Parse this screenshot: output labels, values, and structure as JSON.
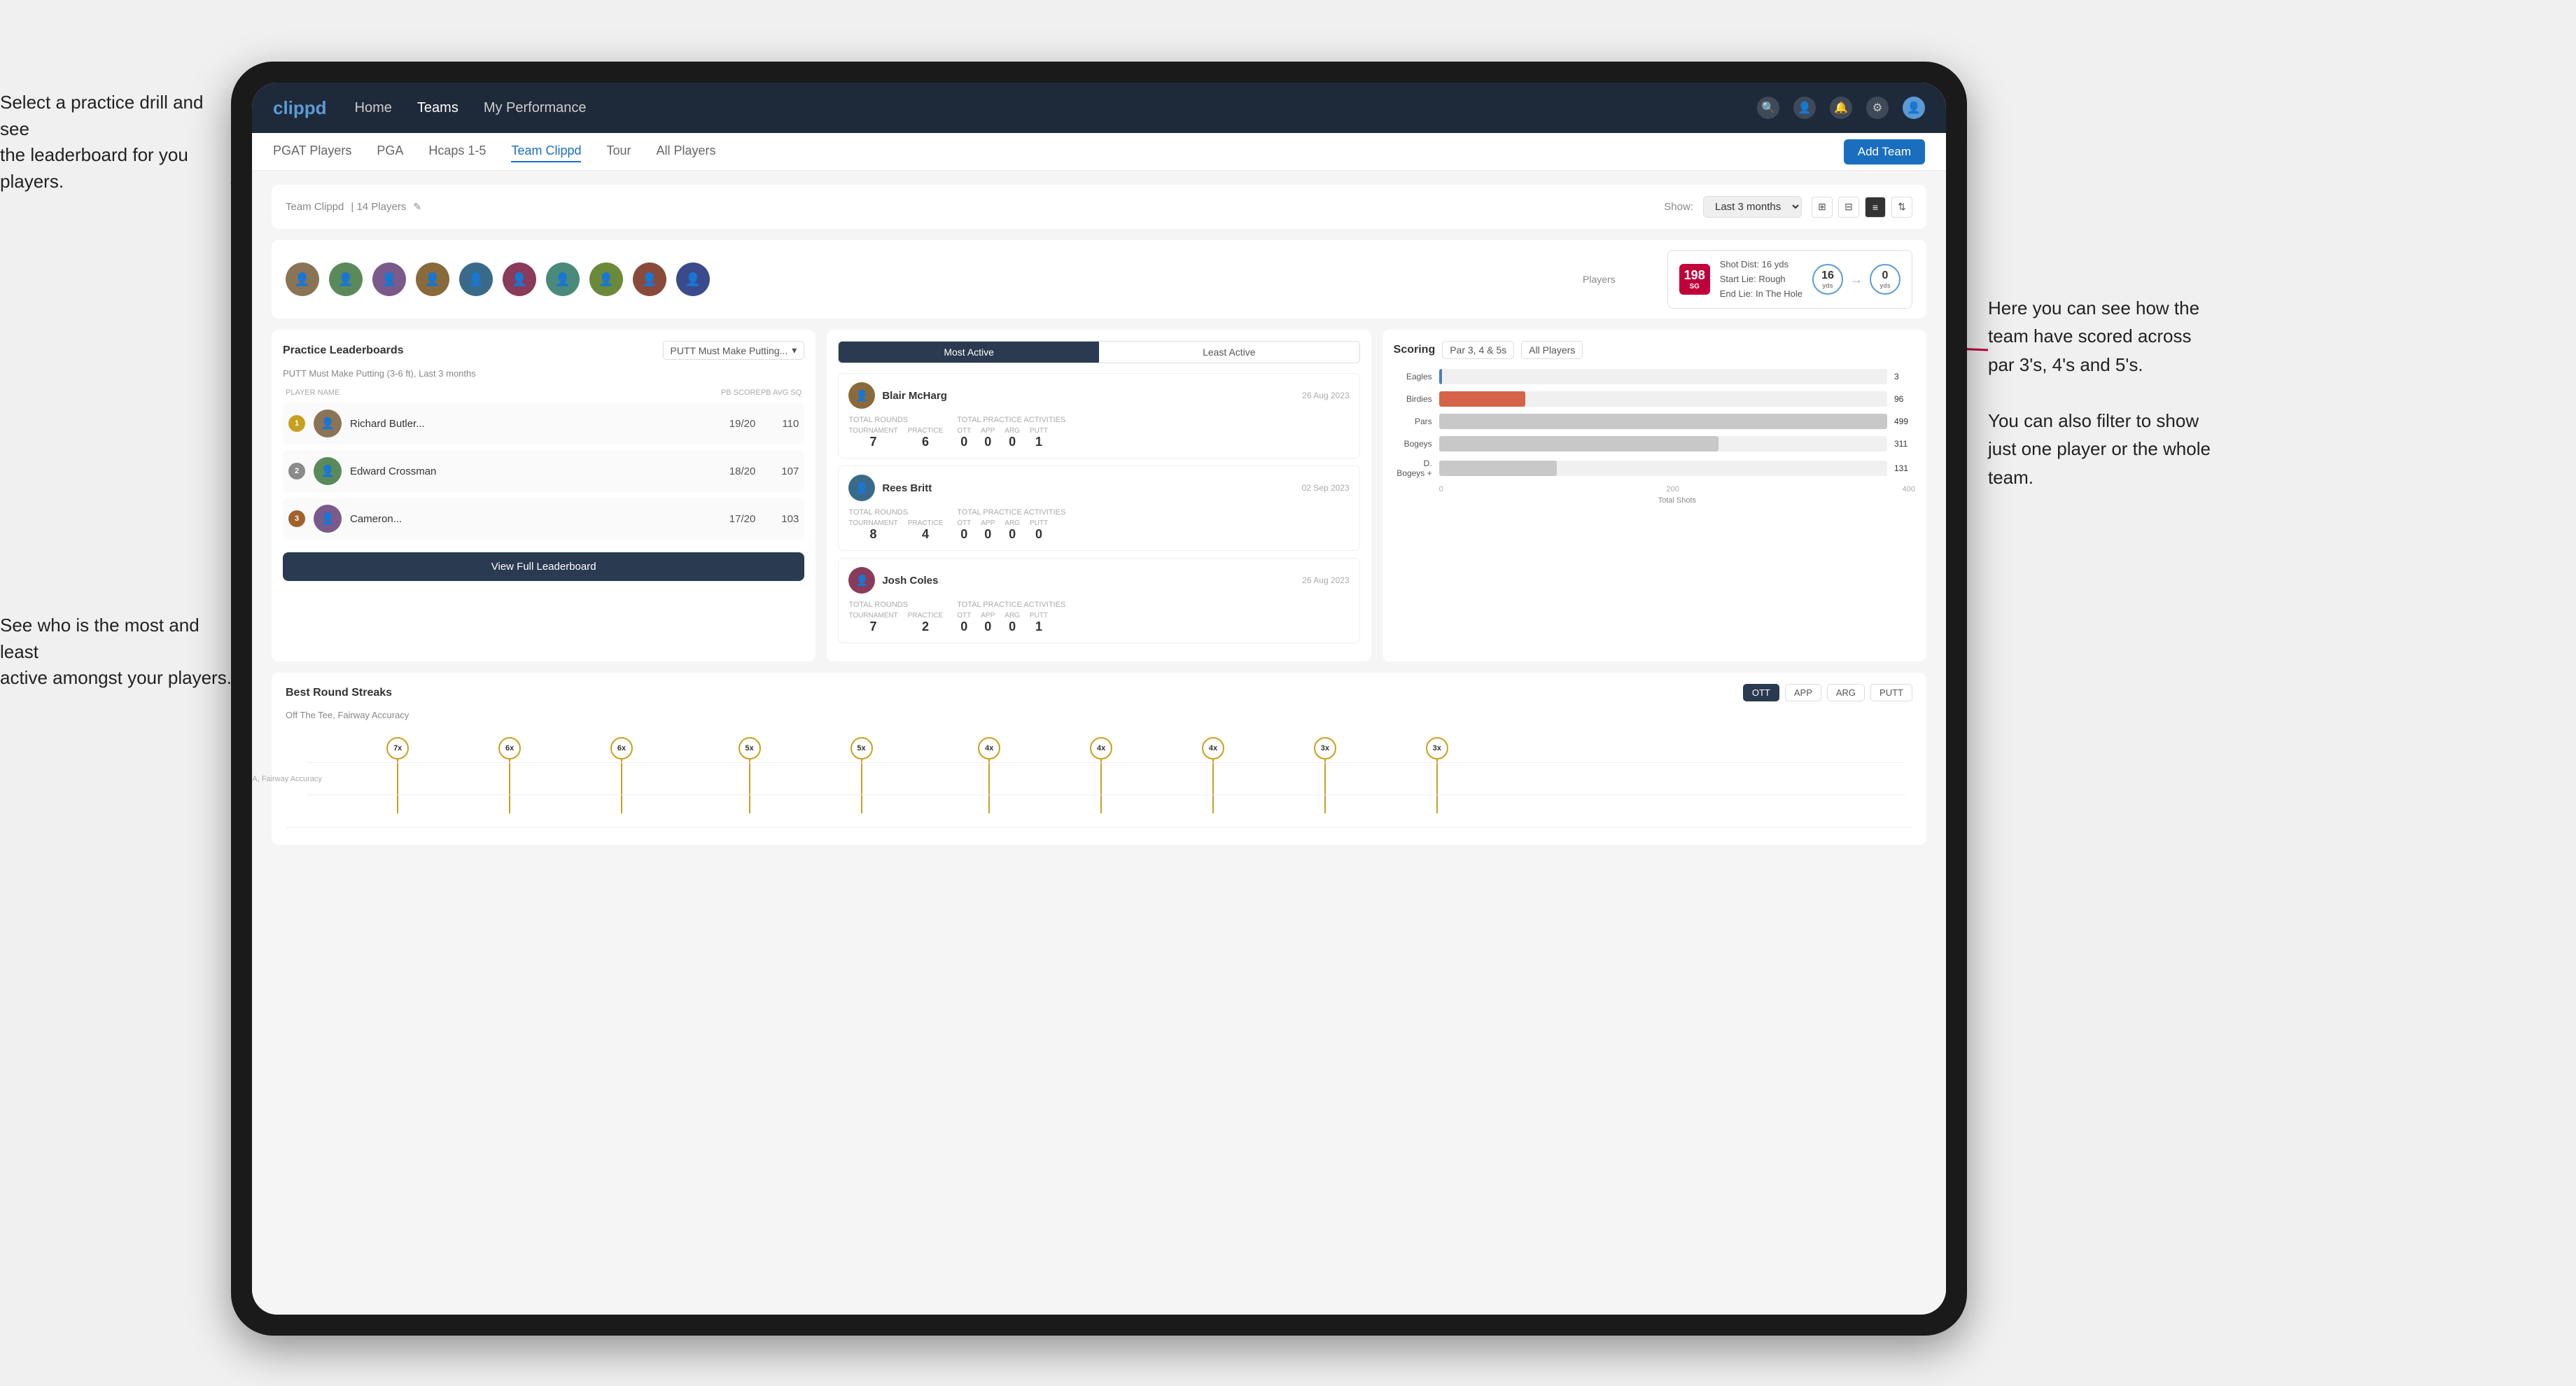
{
  "annotations": {
    "top_left": "Select a practice drill and see\nthe leaderboard for you players.",
    "bottom_left": "See who is the most and least\nactive amongst your players.",
    "top_right": "Here you can see how the\nteam have scored across\npar 3's, 4's and 5's.\n\nYou can also filter to show\njust one player or the whole\nteam.",
    "arrow1_label": "",
    "arrow2_label": ""
  },
  "navbar": {
    "logo": "clippd",
    "links": [
      "Home",
      "Teams",
      "My Performance"
    ],
    "active_link": "Teams",
    "icons": [
      "search",
      "user",
      "bell",
      "settings",
      "avatar"
    ]
  },
  "subtabs": {
    "tabs": [
      "PGAT Players",
      "PGA",
      "Hcaps 1-5",
      "Team Clippd",
      "Tour",
      "All Players"
    ],
    "active_tab": "Team Clippd",
    "add_button": "Add Team"
  },
  "team_header": {
    "title": "Team Clippd",
    "player_count": "14 Players",
    "show_label": "Show:",
    "period": "Last 3 months",
    "view_options": [
      "grid-small",
      "grid-medium",
      "list",
      "sort"
    ]
  },
  "players_section": {
    "label": "Players",
    "avatars": [
      "A",
      "B",
      "C",
      "D",
      "E",
      "F",
      "G",
      "H",
      "I",
      "J"
    ],
    "score_card": {
      "badge": "198",
      "badge_sub": "SG",
      "details_line1": "Shot Dist: 16 yds",
      "details_line2": "Start Lie: Rough",
      "details_line3": "End Lie: In The Hole",
      "circle1": "16",
      "circle1_label": "yds",
      "circle2": "0",
      "circle2_label": "yds"
    }
  },
  "practice_leaderboard": {
    "title": "Practice Leaderboards",
    "drill": "PUTT Must Make Putting...",
    "subtitle": "PUTT Must Make Putting (3-6 ft), Last 3 months",
    "col_player": "PLAYER NAME",
    "col_score": "PB SCORE",
    "col_avg": "PB AVG SQ",
    "players": [
      {
        "rank": 1,
        "rank_color": "gold",
        "name": "Richard Butler...",
        "score": "19/20",
        "avg": "110"
      },
      {
        "rank": 2,
        "rank_color": "silver",
        "name": "Edward Crossman",
        "score": "18/20",
        "avg": "107"
      },
      {
        "rank": 3,
        "rank_color": "bronze",
        "name": "Cameron...",
        "score": "17/20",
        "avg": "103"
      }
    ],
    "view_button": "View Full Leaderboard"
  },
  "activity_panel": {
    "tab_active": "Most Active",
    "tab_inactive": "Least Active",
    "players": [
      {
        "name": "Blair McHarg",
        "date": "26 Aug 2023",
        "total_rounds_label": "Total Rounds",
        "tournament": "7",
        "practice": "6",
        "practice_activities_label": "Total Practice Activities",
        "ott": "0",
        "app": "0",
        "arg": "0",
        "putt": "1"
      },
      {
        "name": "Rees Britt",
        "date": "02 Sep 2023",
        "total_rounds_label": "Total Rounds",
        "tournament": "8",
        "practice": "4",
        "practice_activities_label": "Total Practice Activities",
        "ott": "0",
        "app": "0",
        "arg": "0",
        "putt": "0"
      },
      {
        "name": "Josh Coles",
        "date": "26 Aug 2023",
        "total_rounds_label": "Total Rounds",
        "tournament": "7",
        "practice": "2",
        "practice_activities_label": "Total Practice Activities",
        "ott": "0",
        "app": "0",
        "arg": "0",
        "putt": "1"
      }
    ]
  },
  "scoring_panel": {
    "title": "Scoring",
    "filter1": "Par 3, 4 & 5s",
    "filter2": "All Players",
    "bars": [
      {
        "label": "Eagles",
        "value": 3,
        "max": 499,
        "color": "eagles",
        "display": "3"
      },
      {
        "label": "Birdies",
        "value": 96,
        "max": 499,
        "color": "birdies",
        "display": "96"
      },
      {
        "label": "Pars",
        "value": 499,
        "max": 499,
        "color": "pars",
        "display": "499"
      },
      {
        "label": "Bogeys",
        "value": 311,
        "max": 499,
        "color": "bogeys",
        "display": "311"
      },
      {
        "label": "D. Bogeys +",
        "value": 131,
        "max": 499,
        "color": "dbogeys",
        "display": "131"
      }
    ],
    "axis_labels": [
      "0",
      "200",
      "400"
    ],
    "axis_title": "Total Shots"
  },
  "streaks_panel": {
    "title": "Best Round Streaks",
    "subtitle": "Off The Tee, Fairway Accuracy",
    "tabs": [
      "OTT",
      "APP",
      "ARG",
      "PUTT"
    ],
    "active_tab": "OTT",
    "pins": [
      {
        "x": 5,
        "label": "7x"
      },
      {
        "x": 12,
        "label": "6x"
      },
      {
        "x": 19,
        "label": "6x"
      },
      {
        "x": 27,
        "label": "5x"
      },
      {
        "x": 34,
        "label": "5x"
      },
      {
        "x": 42,
        "label": "4x"
      },
      {
        "x": 49,
        "label": "4x"
      },
      {
        "x": 56,
        "label": "4x"
      },
      {
        "x": 63,
        "label": "3x"
      },
      {
        "x": 70,
        "label": "3x"
      }
    ]
  },
  "all_players_text": "AIl Players"
}
